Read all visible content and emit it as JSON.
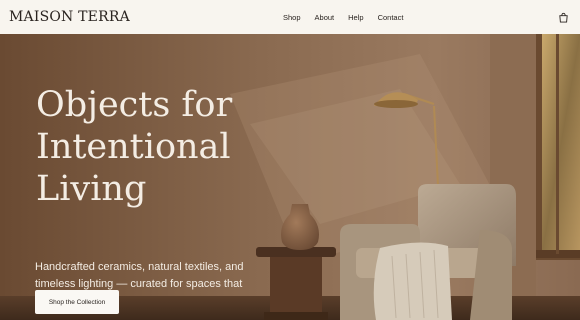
{
  "header": {
    "logo": "MAISON TERRA",
    "nav": [
      {
        "label": "Shop"
      },
      {
        "label": "About"
      },
      {
        "label": "Help"
      },
      {
        "label": "Contact"
      }
    ],
    "cart_icon": "shopping-bag-icon"
  },
  "hero": {
    "title": "Objects  for\nIntentional\nLiving",
    "subtitle": "Handcrafted ceramics, natural textiles, and timeless lighting — curated for spaces that breathe.",
    "cta_label": "Shop the Collection",
    "image_alt_subjects": [
      "floor-lamp",
      "vase",
      "side-table",
      "armchair",
      "window"
    ]
  },
  "colors": {
    "header_bg": "#f8f5ef",
    "hero_text": "#f4ede4",
    "button_bg": "#faf8f4",
    "dark_text": "#2a2420"
  }
}
